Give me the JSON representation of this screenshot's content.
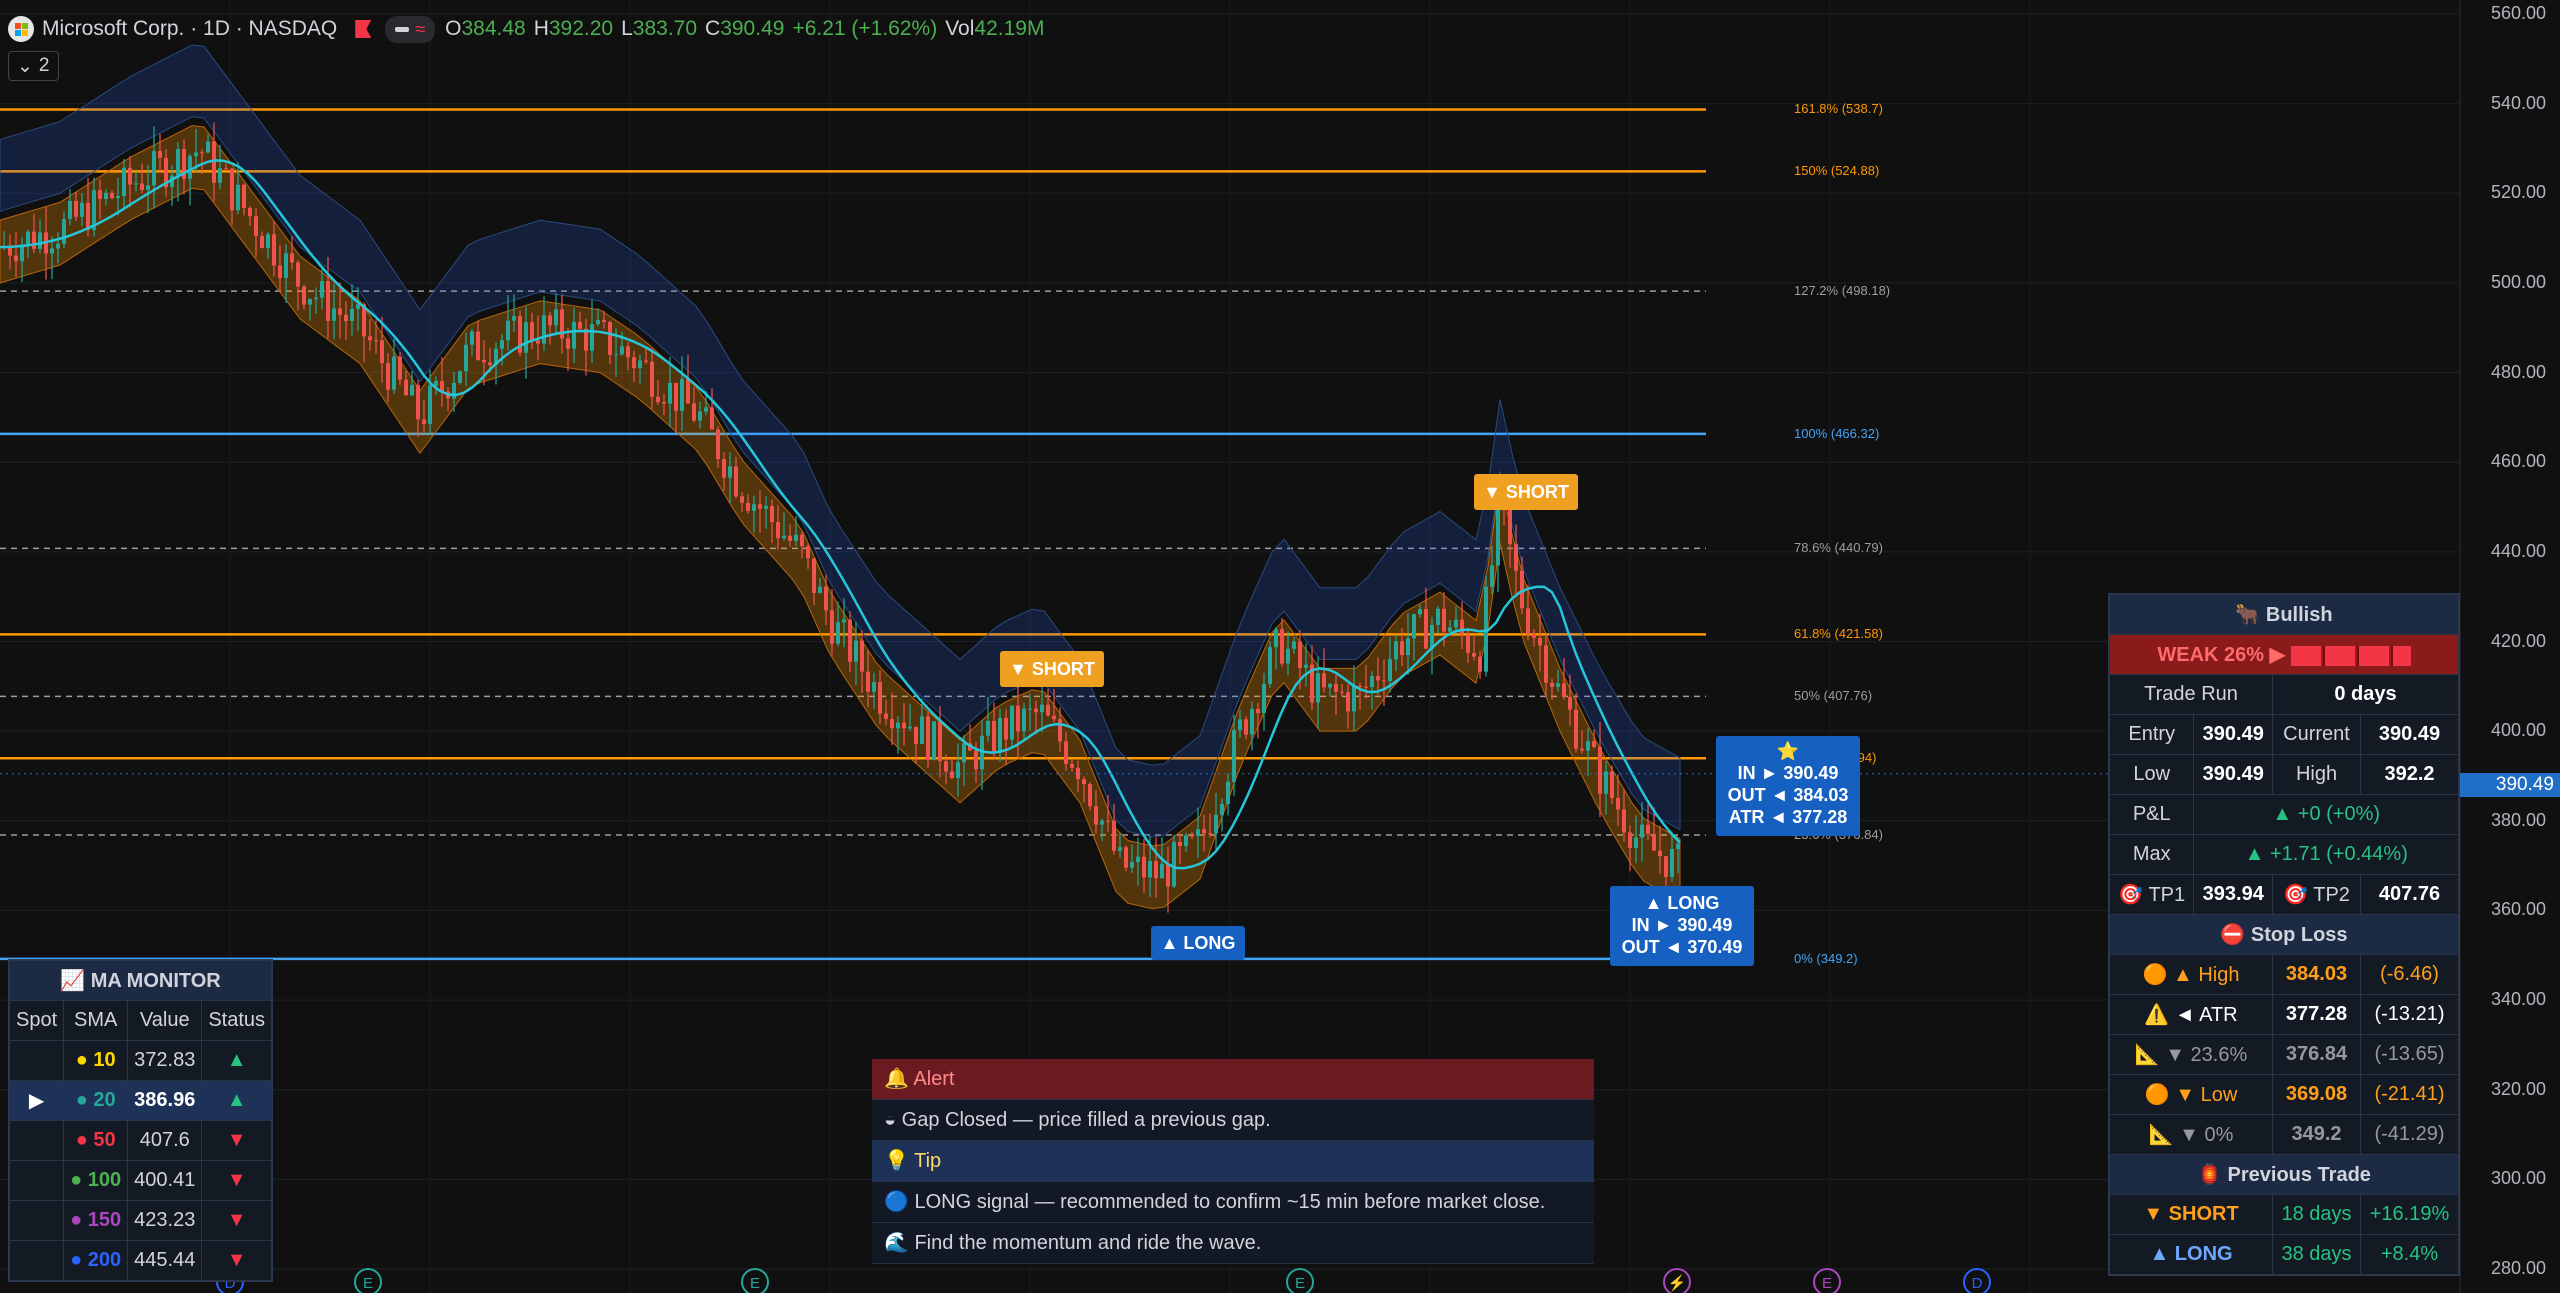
{
  "header": {
    "symbol": "Microsoft Corp. · 1D · NASDAQ",
    "open_key": "O",
    "open": "384.48",
    "high_key": "H",
    "high": "392.20",
    "low_key": "L",
    "low": "383.70",
    "close_key": "C",
    "close": "390.49",
    "change": "+6.21 (+1.62%)",
    "vol_key": "Vol",
    "vol": "42.19M",
    "indicator_count": "2"
  },
  "price_axis": [
    "560.00",
    "540.00",
    "520.00",
    "500.00",
    "480.00",
    "460.00",
    "440.00",
    "420.00",
    "400.00",
    "380.00",
    "360.00",
    "340.00",
    "320.00",
    "300.00",
    "280.00"
  ],
  "current_price_label": "390.49",
  "fib_levels": [
    {
      "label": "161.8% (538.7)",
      "price": 538.7,
      "color": "#ff9800",
      "style": "solid"
    },
    {
      "label": "150% (524.88)",
      "price": 524.88,
      "color": "#ff9800",
      "style": "solid"
    },
    {
      "label": "127.2% (498.18)",
      "price": 498.18,
      "color": "#9e9e9e",
      "style": "dashed"
    },
    {
      "label": "100% (466.32)",
      "price": 466.32,
      "color": "#42a5f5",
      "style": "solid"
    },
    {
      "label": "78.6% (440.79)",
      "price": 440.79,
      "color": "#9e9e9e",
      "style": "dashed"
    },
    {
      "label": "61.8% (421.58)",
      "price": 421.58,
      "color": "#ff9800",
      "style": "solid"
    },
    {
      "label": "50% (407.76)",
      "price": 407.76,
      "color": "#9e9e9e",
      "style": "dashed"
    },
    {
      "label": ".94)",
      "price": 393.94,
      "color": "#ff9800",
      "style": "solid"
    },
    {
      "label": "23.6% (376.84)",
      "price": 376.84,
      "color": "#9e9e9e",
      "style": "dashed"
    },
    {
      "label": "0% (349.2)",
      "price": 349.2,
      "color": "#42a5f5",
      "style": "solid"
    }
  ],
  "signals": {
    "short1": "▼ SHORT",
    "short2": "▼ SHORT",
    "long1": "▲ LONG",
    "long2_title": "▲ LONG",
    "long2_in": "IN ► 390.49",
    "long2_out": "OUT ◄ 370.49",
    "current_in": "IN ► 390.49",
    "current_out": "OUT ◄ 384.03",
    "current_atr": "ATR ◄ 377.28",
    "star": "⭐"
  },
  "ma_monitor": {
    "title": "📈 MA MONITOR",
    "columns": [
      "Spot",
      "SMA",
      "Value",
      "Status"
    ],
    "rows": [
      {
        "spot": "",
        "sma": "● 10",
        "value": "372.83",
        "status": "▲",
        "color": "#ffd600"
      },
      {
        "spot": "▶",
        "sma": "● 20",
        "value": "386.96",
        "status": "▲",
        "color": "#26a69a"
      },
      {
        "spot": "",
        "sma": "● 50",
        "value": "407.6",
        "status": "▼",
        "color": "#f23645"
      },
      {
        "spot": "",
        "sma": "● 100",
        "value": "400.41",
        "status": "▼",
        "color": "#4caf50"
      },
      {
        "spot": "",
        "sma": "● 150",
        "value": "423.23",
        "status": "▼",
        "color": "#ab47bc"
      },
      {
        "spot": "",
        "sma": "● 200",
        "value": "445.44",
        "status": "▼",
        "color": "#2962ff"
      }
    ]
  },
  "trade_panel": {
    "title": "🐂 Bullish",
    "strength": "WEAK  26%  ▶",
    "trade_run_label": "Trade Run",
    "trade_run": "0 days",
    "entry_label": "Entry",
    "entry": "390.49",
    "current_label": "Current",
    "current": "390.49",
    "low_label": "Low",
    "low": "390.49",
    "high_label": "High",
    "high": "392.2",
    "pnl_label": "P&L",
    "pnl": "▲ +0  (+0%)",
    "max_label": "Max",
    "max": "▲ +1.71  (+0.44%)",
    "tp1_label": "🎯 TP1",
    "tp1": "393.94",
    "tp2_label": "🎯 TP2",
    "tp2": "407.76",
    "stop_title": "⛔ Stop Loss",
    "stops": [
      {
        "icon": "🟠",
        "label": "▲ High",
        "value": "384.03",
        "diff": "(-6.46)",
        "cls": "ora"
      },
      {
        "icon": "⚠️",
        "label": "◄ ATR",
        "value": "377.28",
        "diff": "(-13.21)",
        "cls": "bf"
      },
      {
        "icon": "📐",
        "label": "▼ 23.6%",
        "value": "376.84",
        "diff": "(-13.65)",
        "cls": "grey"
      },
      {
        "icon": "🟠",
        "label": "▼ Low",
        "value": "369.08",
        "diff": "(-21.41)",
        "cls": "ora"
      },
      {
        "icon": "📐",
        "label": "▼ 0%",
        "value": "349.2",
        "diff": "(-41.29)",
        "cls": "grey"
      }
    ],
    "prev_title": "🏮 Previous Trade",
    "prev": [
      {
        "label": "▼ SHORT",
        "days": "18 days",
        "pct": "+16.19%",
        "cls": "ora"
      },
      {
        "label": "▲ LONG",
        "days": "38 days",
        "pct": "+8.4%",
        "cls": "blue"
      }
    ]
  },
  "alerts": [
    {
      "text": "🔔 Alert",
      "type": "header-red"
    },
    {
      "text": "◒ Gap Closed — price filled a previous gap.",
      "type": "row"
    },
    {
      "text": "💡 Tip",
      "type": "header-blue"
    },
    {
      "text": "🔵 LONG signal — recommended to confirm ~15 min before market close.",
      "type": "row"
    },
    {
      "text": "🌊 Find the momentum and ride the wave.",
      "type": "row"
    }
  ],
  "colors": {
    "up": "#26a69a",
    "down": "#ef5350",
    "orange": "#ff9800",
    "blue": "#2962ff",
    "cyan": "#26c6da"
  }
}
